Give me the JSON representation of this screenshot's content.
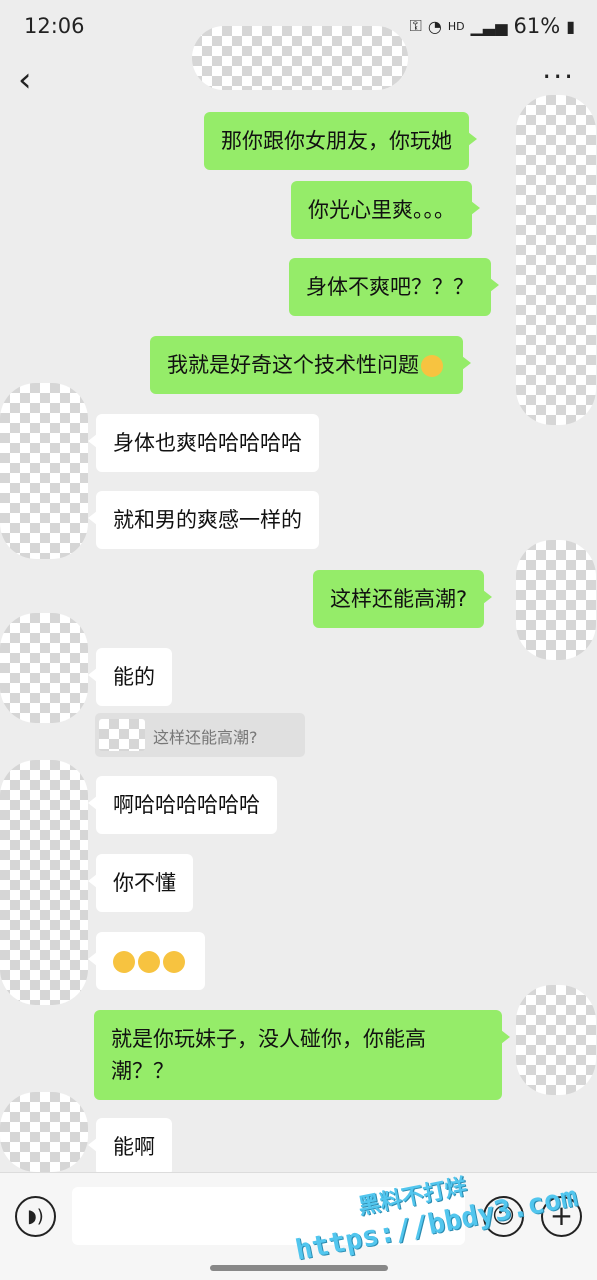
{
  "status_bar": {
    "time": "12:06",
    "battery": "61%",
    "icons": [
      "key-icon",
      "wifi-icon",
      "hd-icon",
      "signal-icon",
      "battery-icon"
    ]
  },
  "header": {
    "back_icon": "chevron-left-icon",
    "more_label": "···"
  },
  "messages": [
    {
      "side": "out",
      "text": "那你跟你女朋友，你玩她"
    },
    {
      "side": "out",
      "text": "你光心里爽。。。"
    },
    {
      "side": "out",
      "text": "身体不爽吧？？？"
    },
    {
      "side": "out",
      "text": "我就是好奇这个技术性问题",
      "emoji": "flushed-face-emoji"
    },
    {
      "side": "in",
      "text": "身体也爽哈哈哈哈哈"
    },
    {
      "side": "in",
      "text": "就和男的爽感一样的"
    },
    {
      "side": "out",
      "text": "这样还能高潮?"
    },
    {
      "side": "in",
      "text": "能的"
    },
    {
      "side": "in",
      "text": "啊哈哈哈哈哈哈"
    },
    {
      "side": "in",
      "text": "你不懂"
    },
    {
      "side": "in",
      "text": "",
      "emoji": "smirking-face-emoji x3"
    },
    {
      "side": "out",
      "text_line1": "就是你玩妹子，没人碰你，你能高",
      "text_line2": "潮？？"
    },
    {
      "side": "in",
      "text": "能啊"
    }
  ],
  "quote": {
    "text": "这样还能高潮?"
  },
  "input_bar": {
    "voice_icon": "voice-icon",
    "emoji_icon": "emoji-icon",
    "plus_icon": "plus-icon",
    "input_value": ""
  },
  "watermark": {
    "line1": "黑料不打烊",
    "line2": "https://bbdy3.com"
  },
  "colors": {
    "outgoing_bubble": "#95ec69",
    "incoming_bubble": "#ffffff",
    "background": "#ededed"
  }
}
